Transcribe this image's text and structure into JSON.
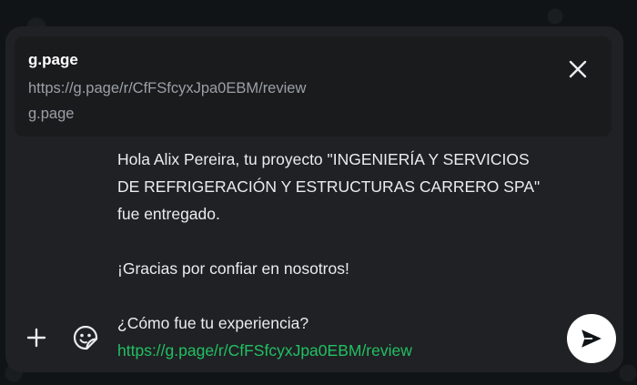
{
  "link_preview": {
    "title": "g.page",
    "url": "https://g.page/r/CfFSfcyxJpa0EBM/review",
    "domain": "g.page",
    "close_icon": "close-icon"
  },
  "message": {
    "line1": "Hola Alix Pereira, tu proyecto \"INGENIERÍA Y SERVICIOS DE REFRIGERACIÓN Y ESTRUCTURAS CARRERO SPA\" fue entregado.",
    "line2": "¡Gracias por confiar en nosotros!",
    "line3": "¿Cómo fue tu experiencia?",
    "link": "https://g.page/r/CfFSfcyxJpa0EBM/review"
  },
  "toolbar": {
    "attach_icon": "plus-icon",
    "sticker_icon": "sticker-icon",
    "send_icon": "send-icon"
  },
  "colors": {
    "background": "#111417",
    "composer": "#202124",
    "preview": "#1a1b1d",
    "text": "#e9edef",
    "muted": "#9aa0a6",
    "link": "#21c063",
    "send_button": "#ffffff"
  }
}
